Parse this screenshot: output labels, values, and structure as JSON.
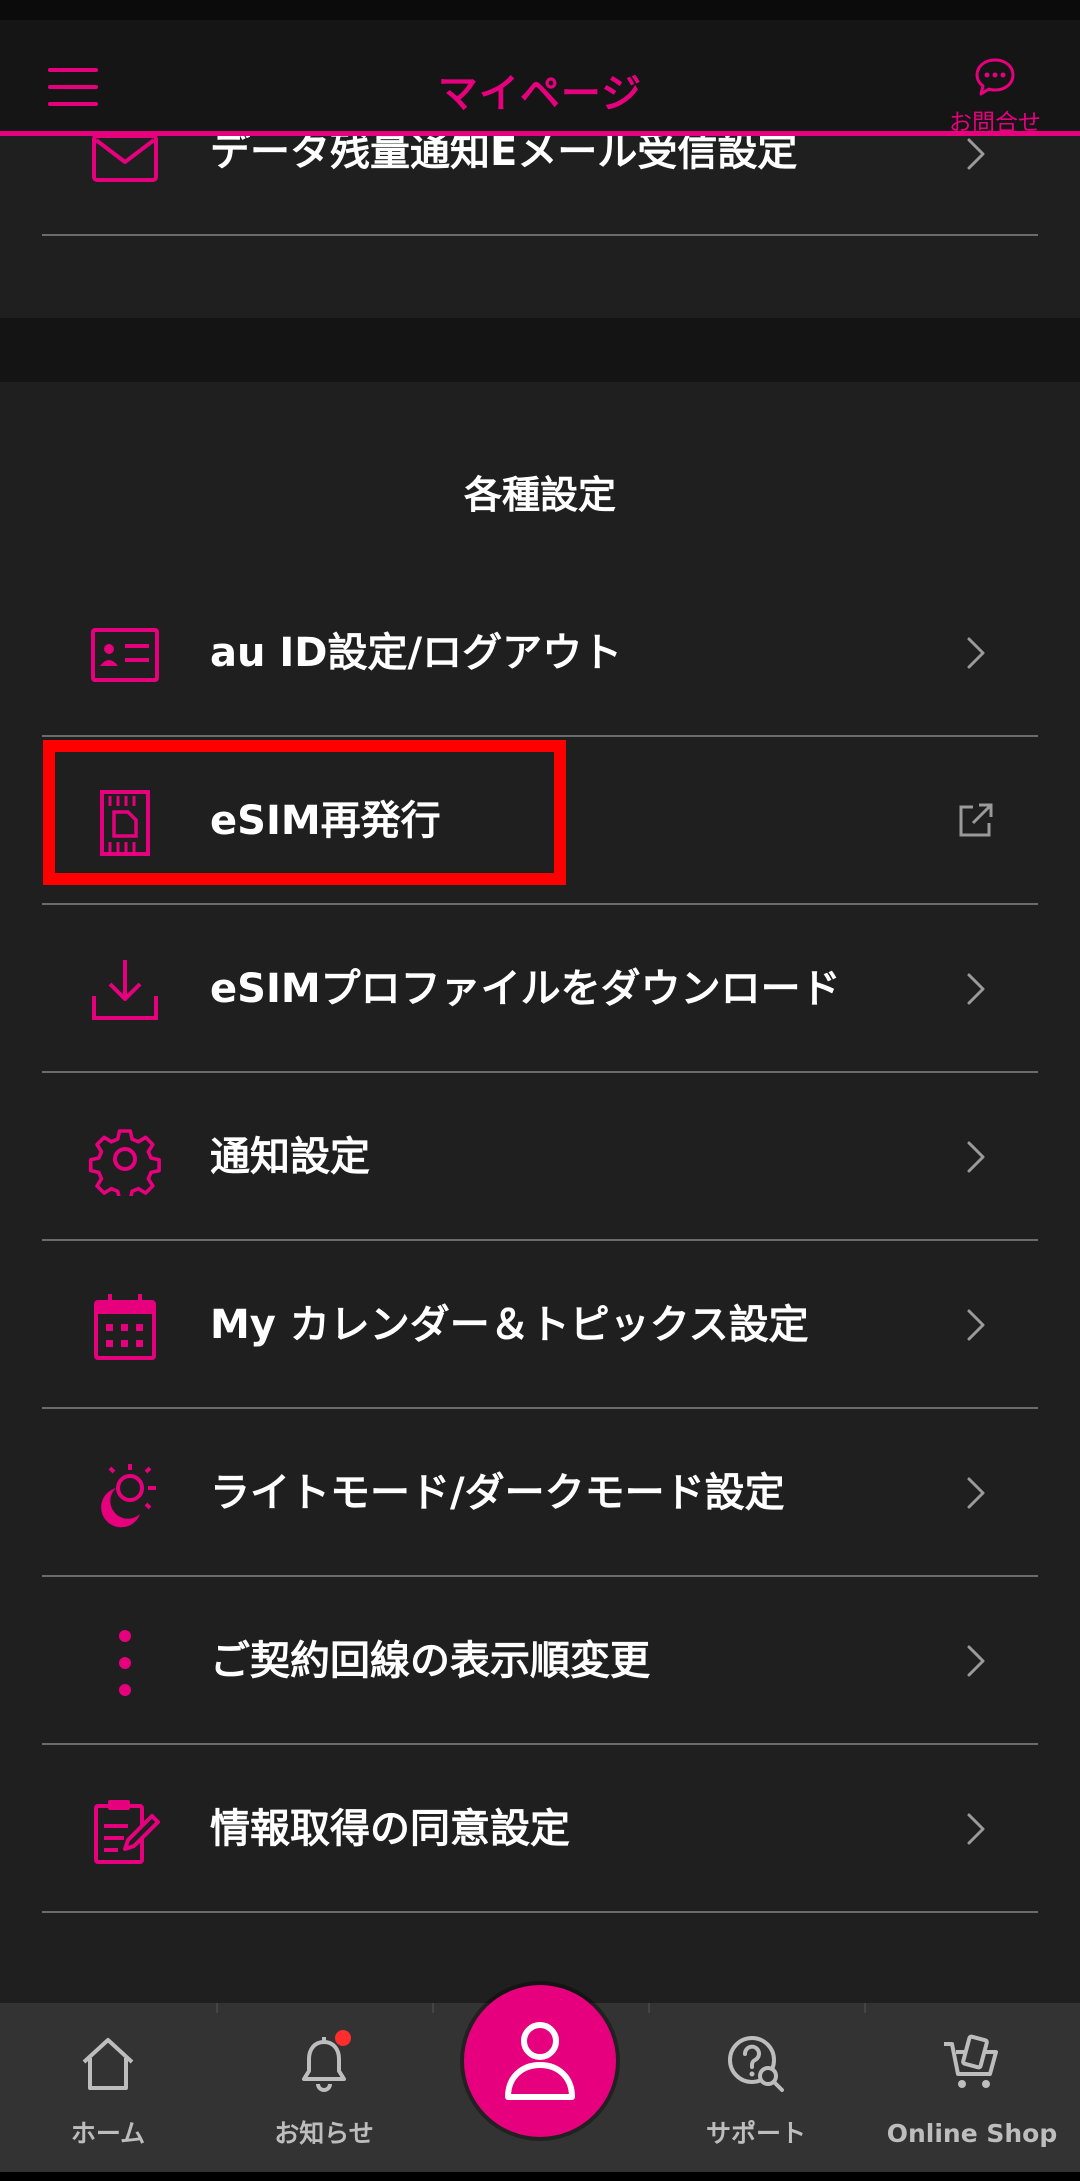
{
  "header": {
    "title": "マイページ",
    "contact_label": "お問合せ",
    "accent_color": "#e6007e"
  },
  "top_item": {
    "label": "データ残量通知Eメール受信設定",
    "icon": "mail-icon"
  },
  "section": {
    "title": "各種設定"
  },
  "settings_items": [
    {
      "label": "au ID設定/ログアウト",
      "icon": "id-card-icon",
      "trail": "chevron-right"
    },
    {
      "label": "eSIM再発行",
      "icon": "sim-card-icon",
      "trail": "external-link"
    },
    {
      "label": "eSIMプロファイルをダウンロード",
      "icon": "download-icon",
      "trail": "chevron-right"
    },
    {
      "label": "通知設定",
      "icon": "gear-icon",
      "trail": "chevron-right"
    },
    {
      "label": "My カレンダー＆トピックス設定",
      "icon": "calendar-icon",
      "trail": "chevron-right"
    },
    {
      "label": "ライトモード/ダークモード設定",
      "icon": "moon-sun-icon",
      "trail": "chevron-right"
    },
    {
      "label": "ご契約回線の表示順変更",
      "icon": "vertical-dots-icon",
      "trail": "chevron-right"
    },
    {
      "label": "情報取得の同意設定",
      "icon": "clipboard-pen-icon",
      "trail": "chevron-right"
    }
  ],
  "bottom_nav": {
    "items": [
      {
        "label": "ホーム",
        "icon": "home-icon"
      },
      {
        "label": "お知らせ",
        "icon": "bell-icon",
        "badge": true
      },
      {
        "label": "",
        "icon": "person-icon",
        "center": true
      },
      {
        "label": "サポート",
        "icon": "support-icon"
      },
      {
        "label": "Online Shop",
        "icon": "cart-icon"
      }
    ]
  },
  "colors": {
    "background": "#1f1f1f",
    "accent": "#e6007e",
    "divider": "#6b6b6b",
    "highlight": "#ff0000",
    "nav_bg": "#333333"
  }
}
